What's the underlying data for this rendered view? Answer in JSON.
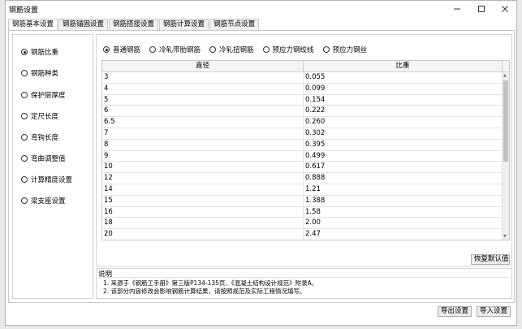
{
  "window": {
    "title": "钢筋设置"
  },
  "tabs": [
    "钢筋基本设置",
    "钢筋锚固设置",
    "钢筋搭接设置",
    "钢筋计算设置",
    "钢筋节点设置"
  ],
  "left_options": [
    "钢筋比重",
    "钢筋种类",
    "保护层厚度",
    "定尺长度",
    "弯钩长度",
    "弯曲调整值",
    "计算精度设置",
    "梁支座设置"
  ],
  "left_selected": 0,
  "rebar_types": [
    "普通钢筋",
    "冷轧带肋钢筋",
    "冷轧扭钢筋",
    "预应力钢绞线",
    "预应力钢丝"
  ],
  "rebar_selected": 0,
  "table": {
    "headers": [
      "直径",
      "比重"
    ],
    "rows": [
      [
        "3",
        "0.055"
      ],
      [
        "4",
        "0.099"
      ],
      [
        "5",
        "0.154"
      ],
      [
        "6",
        "0.222"
      ],
      [
        "6.5",
        "0.260"
      ],
      [
        "7",
        "0.302"
      ],
      [
        "8",
        "0.395"
      ],
      [
        "9",
        "0.499"
      ],
      [
        "10",
        "0.617"
      ],
      [
        "12",
        "0.888"
      ],
      [
        "14",
        "1.21"
      ],
      [
        "15",
        "1.388"
      ],
      [
        "16",
        "1.58"
      ],
      [
        "18",
        "2.00"
      ],
      [
        "20",
        "2.47"
      ]
    ]
  },
  "buttons": {
    "restore_default": "恢复默认值",
    "export": "导出设置",
    "import": "导入设置"
  },
  "notes": {
    "title": "说明",
    "lines": [
      "1. 来源于《钢筋工手册》第三版P134-135页、《混凝土结构设计规范》附录A。",
      "2. 该部分内容修改会影响钢筋计算结果，请按照规范及实际工程情况填写。"
    ]
  }
}
